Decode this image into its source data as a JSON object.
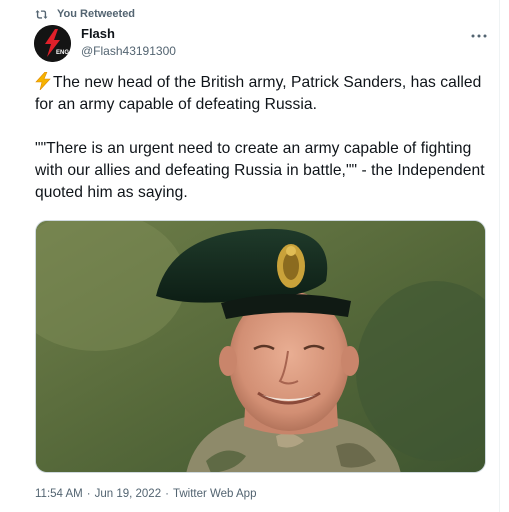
{
  "retweet": {
    "label": "You Retweeted",
    "icon": "retweet-icon"
  },
  "author": {
    "display_name": "Flash",
    "handle": "@Flash43191300",
    "avatar_icon": "lightning-eng-logo",
    "avatar_text": "ENG"
  },
  "tweet": {
    "paragraph1_emoji_icon": "high-voltage-icon",
    "paragraph1": "The new head of the British army, Patrick Sanders, has called for an army capable of defeating Russia.",
    "paragraph2": "\"\"There is an urgent need to create an army capable of fighting with our allies and defeating Russia in battle,\"\" - the Independent quoted him as saying."
  },
  "media": {
    "icon": "photo-of-man-in-beret"
  },
  "meta": {
    "time": "11:54 AM",
    "separator": "·",
    "date": "Jun 19, 2022",
    "source": "Twitter Web App"
  },
  "colors": {
    "text_primary": "#0f1419",
    "text_secondary": "#536471",
    "border": "#cfd9de",
    "avatar_red": "#e0202a",
    "bolt_yellow": "#f6b300"
  }
}
